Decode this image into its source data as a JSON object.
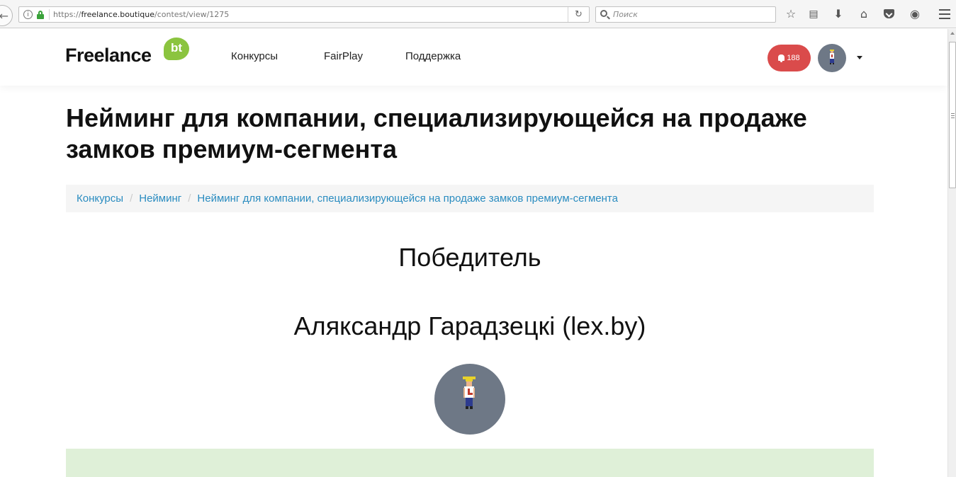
{
  "browser": {
    "url_prefix": "https://",
    "url_domain": "freelance.boutique",
    "url_path": "/contest/view/1275",
    "search_placeholder": "Поиск"
  },
  "header": {
    "logo_text": "Freelance",
    "logo_badge": "bt",
    "nav": [
      {
        "label": "Конкурсы"
      },
      {
        "label": "FairPlay"
      },
      {
        "label": "Поддержка"
      }
    ],
    "notifications_count": "188"
  },
  "page": {
    "title": "Нейминг для компании, специализирующейся на продаже замков премиум-сегмента",
    "breadcrumb": [
      {
        "label": "Конкурсы"
      },
      {
        "label": "Нейминг"
      },
      {
        "label": "Нейминг для компании, специализирующейся на продаже замков премиум-сегмента"
      }
    ],
    "winner_heading": "Победитель",
    "winner_name": "Аляксандр Гарадзецкі (lex.by)"
  },
  "colors": {
    "accent_link": "#2a8cc0",
    "notification_badge": "#da4b4b",
    "logo_green": "#8bc43f",
    "avatar_bg": "#6e7886",
    "success_panel": "#dff0d8"
  }
}
